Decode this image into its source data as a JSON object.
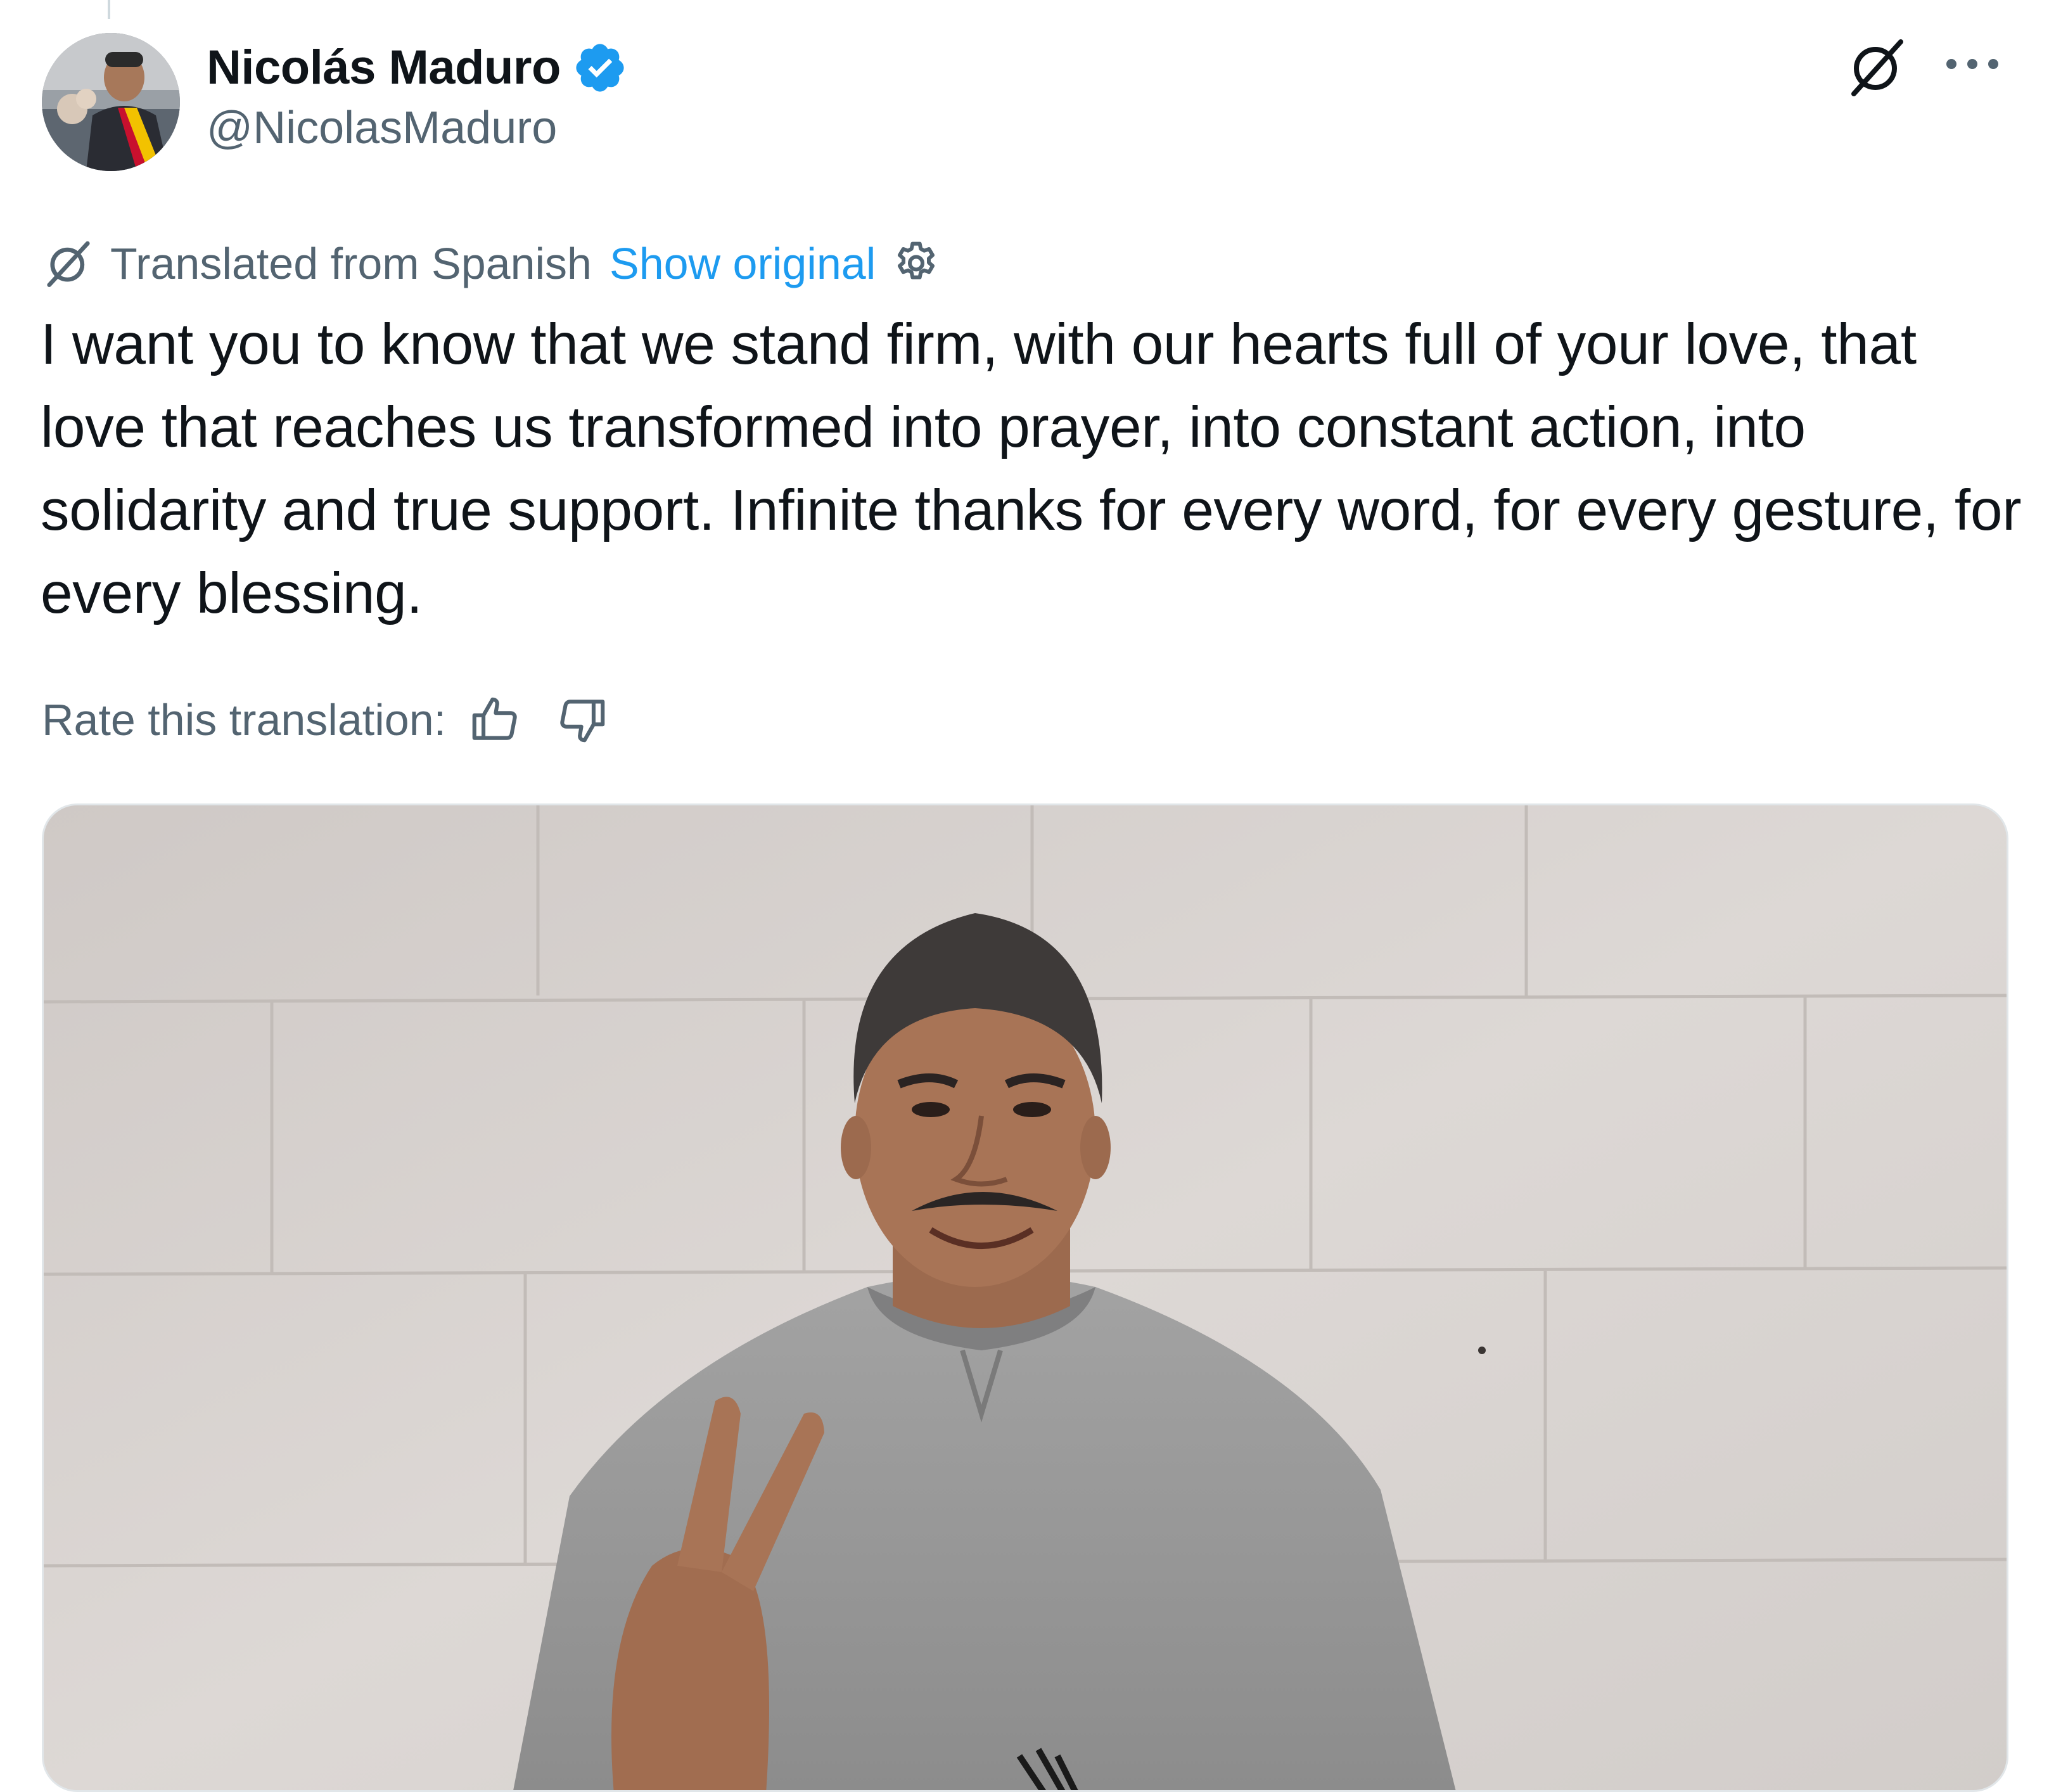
{
  "author": {
    "display_name": "Nicolás Maduro",
    "handle": "@NicolasMaduro",
    "verified": true,
    "verified_color": "#1d9bf0"
  },
  "header_actions": {
    "grok_icon": "grok-icon",
    "more_icon": "more-icon"
  },
  "translation": {
    "notice": "Translated from Spanish",
    "show_original": "Show original",
    "settings_icon": "gear-icon",
    "link_color": "#1d9bf0"
  },
  "tweet": {
    "text": "I want you to know that we stand firm, with our hearts full of your love, that love that reaches us transformed into prayer, into constant action, into solidarity and true support. Infinite thanks for every word, for every gesture, for every blessing."
  },
  "rating": {
    "label": "Rate this translation:",
    "thumbs_up_icon": "thumbs-up-icon",
    "thumbs_down_icon": "thumbs-down-icon"
  },
  "media": {
    "type": "photo",
    "subject": "man in grey sweatshirt making a peace sign in front of a white brick wall"
  },
  "colors": {
    "text_primary": "#0f1419",
    "text_secondary": "#536471",
    "accent": "#1d9bf0"
  }
}
